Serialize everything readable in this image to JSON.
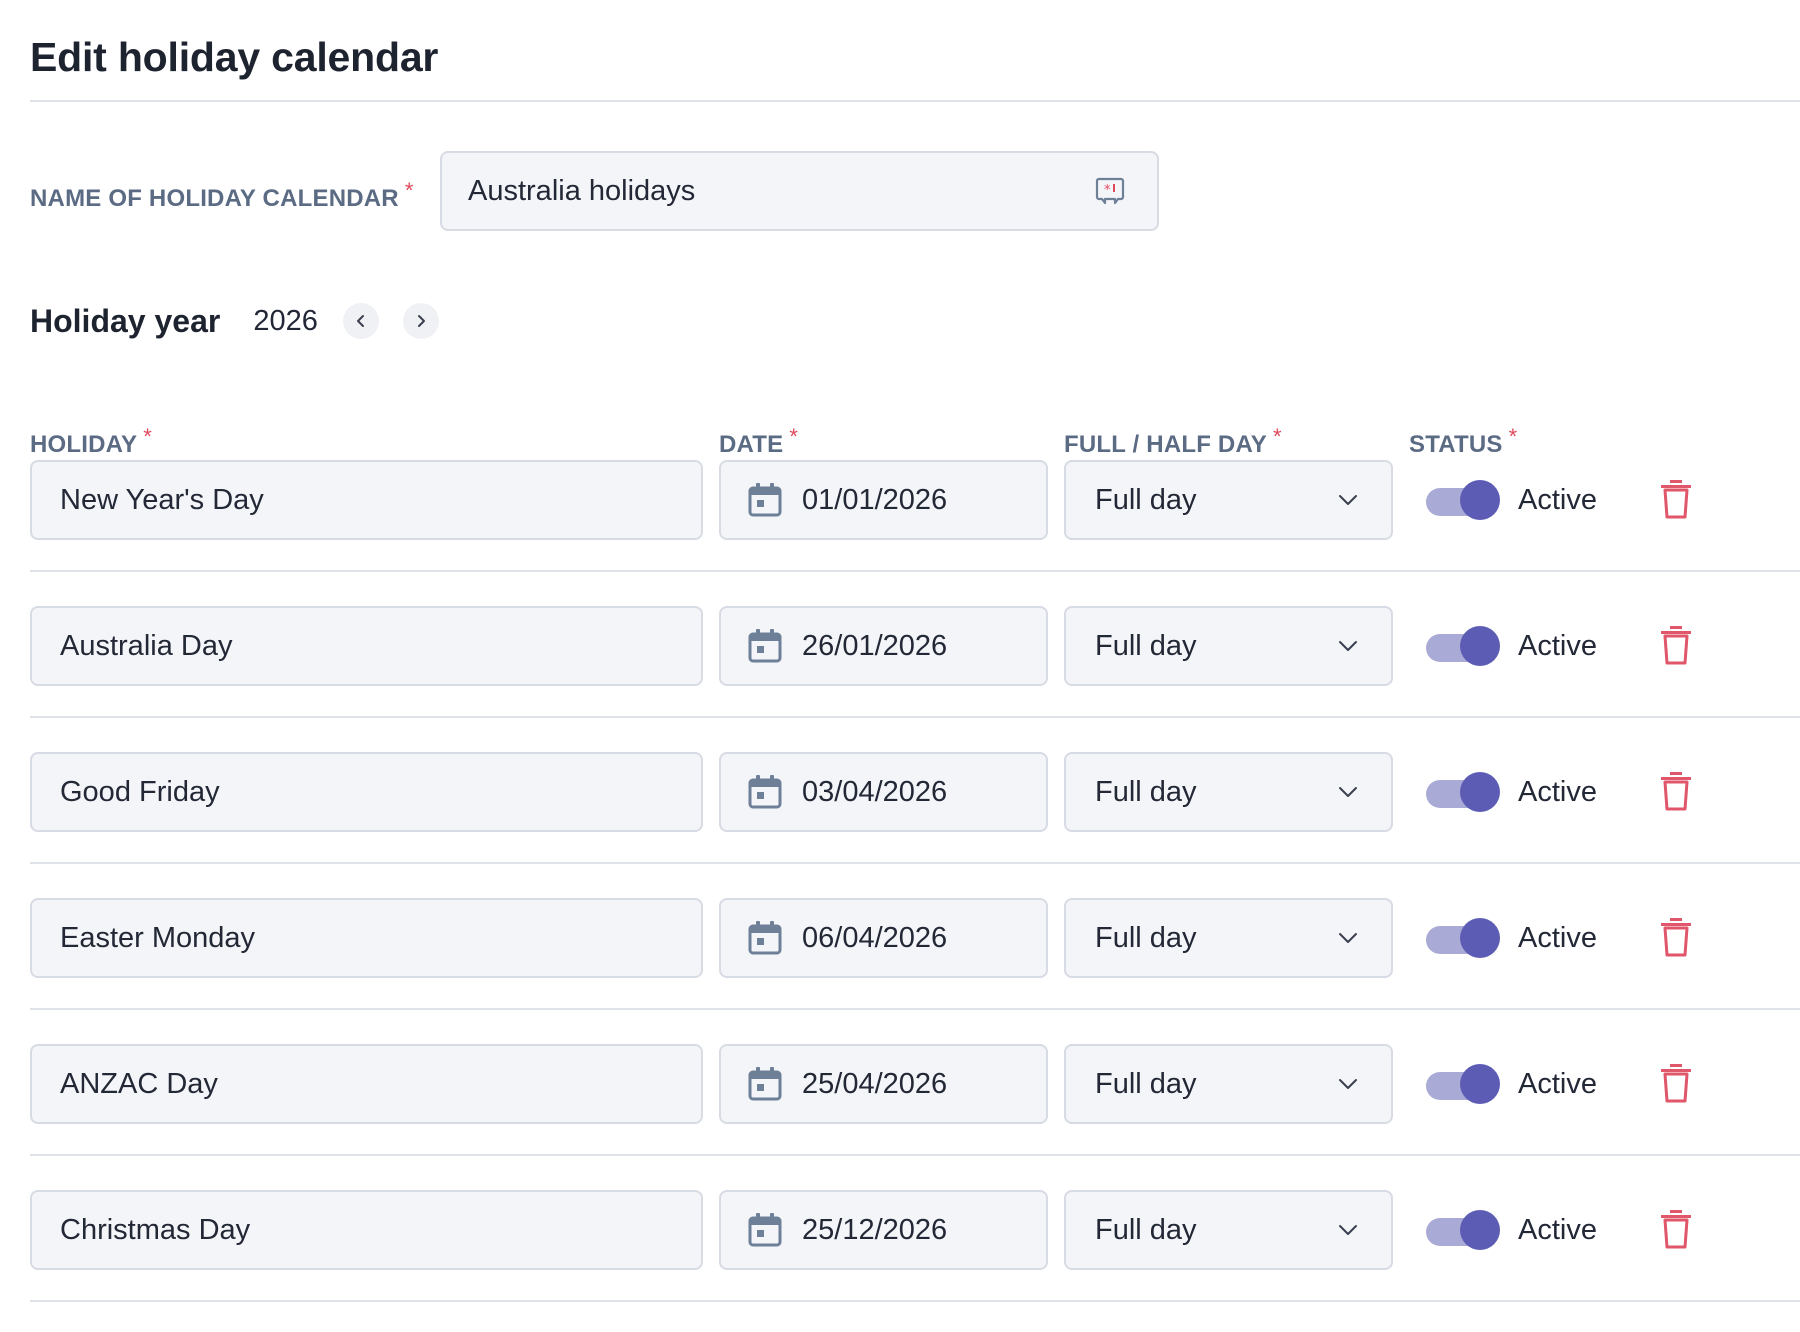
{
  "page": {
    "title": "Edit holiday calendar"
  },
  "calendar_name": {
    "label": "NAME OF HOLIDAY CALENDAR",
    "required_mark": "*",
    "value": "Australia holidays"
  },
  "holiday_year": {
    "label": "Holiday year",
    "value": "2026",
    "prev_icon": "chevron-left-icon",
    "next_icon": "chevron-right-icon"
  },
  "columns": {
    "holiday": "HOLIDAY",
    "date": "DATE",
    "day_type": "FULL / HALF DAY",
    "status": "STATUS",
    "required_mark": "*"
  },
  "holidays": [
    {
      "name": "New Year's Day",
      "date": "01/01/2026",
      "day_type": "Full day",
      "status": "Active",
      "active": true
    },
    {
      "name": "Australia Day",
      "date": "26/01/2026",
      "day_type": "Full day",
      "status": "Active",
      "active": true
    },
    {
      "name": "Good Friday",
      "date": "03/04/2026",
      "day_type": "Full day",
      "status": "Active",
      "active": true
    },
    {
      "name": "Easter Monday",
      "date": "06/04/2026",
      "day_type": "Full day",
      "status": "Active",
      "active": true
    },
    {
      "name": "ANZAC Day",
      "date": "25/04/2026",
      "day_type": "Full day",
      "status": "Active",
      "active": true
    },
    {
      "name": "Christmas Day",
      "date": "25/12/2026",
      "day_type": "Full day",
      "status": "Active",
      "active": true
    }
  ],
  "colors": {
    "label": "#5b6b84",
    "required": "#e0495c",
    "toggle_on_knob": "#5c5cb5",
    "toggle_on_track": "#aaaad6",
    "delete_icon": "#e0566a",
    "input_bg": "#f4f5f8",
    "input_border": "#d7dbe3"
  },
  "icons": {
    "date": "calendar-icon",
    "dropdown": "chevron-down-icon",
    "delete": "trash-icon",
    "name_addon": "required-flag-icon"
  }
}
